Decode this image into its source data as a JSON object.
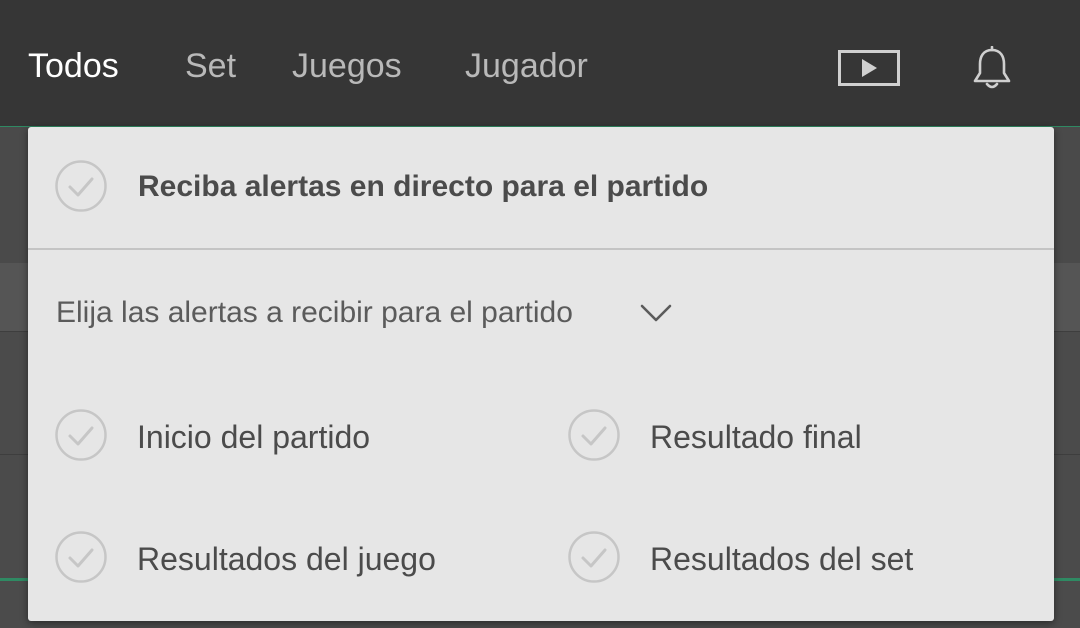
{
  "tabs": [
    {
      "label": "Todos",
      "active": true
    },
    {
      "label": "Set",
      "active": false
    },
    {
      "label": "Juegos",
      "active": false
    },
    {
      "label": "Jugador",
      "active": false
    }
  ],
  "header_icons": [
    "tv-play-icon",
    "bell-icon"
  ],
  "alerts_panel": {
    "master_toggle_label": "Reciba alertas en directo para el partido",
    "choose_label": "Elija las alertas a recibir para el partido",
    "options": [
      {
        "label": "Inicio del partido",
        "checked": false
      },
      {
        "label": "Resultado final",
        "checked": false
      },
      {
        "label": "Resultados del juego",
        "checked": false
      },
      {
        "label": "Resultados del set",
        "checked": false
      }
    ]
  },
  "colors": {
    "topbar": "#363636",
    "accent": "#2f8a63",
    "panel_bg": "#e6e6e6",
    "text": "#4b4b4b"
  }
}
